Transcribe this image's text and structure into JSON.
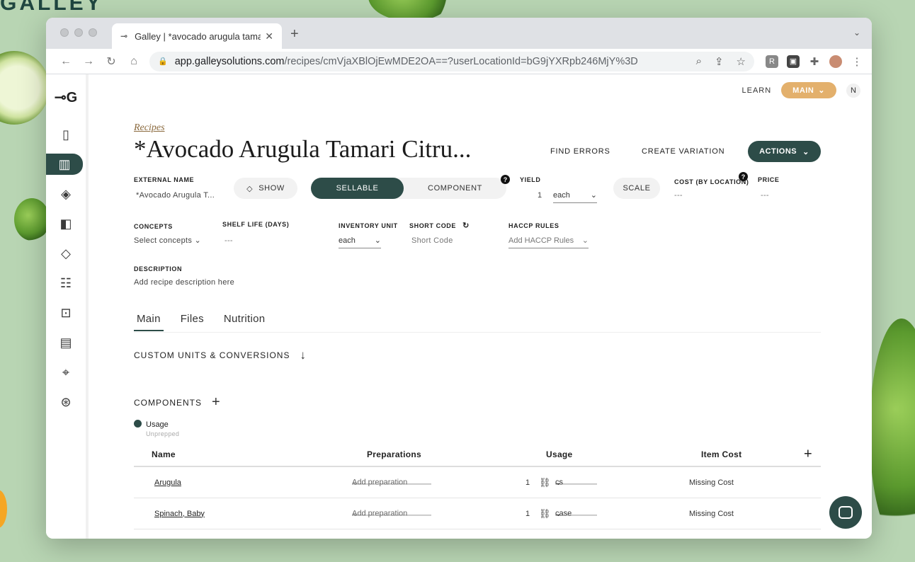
{
  "background": {
    "brand_text": "GALLEY"
  },
  "browser": {
    "tab_title": "Galley | *avocado arugula tama",
    "url_host": "app.galleysolutions.com",
    "url_path": "/recipes/cmVjaXBlOjEwMDE2OA==?userLocationId=bG9jYXRpb246MjY%3D"
  },
  "header": {
    "learn": "LEARN",
    "location": "MAIN",
    "user_initial": "N"
  },
  "recipe": {
    "breadcrumb": "Recipes",
    "title": "*Avocado Arugula Tamari Citru...",
    "find_errors": "FIND ERRORS",
    "create_variation": "CREATE VARIATION",
    "actions": "ACTIONS"
  },
  "fields": {
    "external_name_label": "EXTERNAL NAME",
    "external_name_value": "*Avocado Arugula T...",
    "show_label": "SHOW",
    "sellable_label": "SELLABLE",
    "component_label": "COMPONENT",
    "yield_label": "YIELD",
    "yield_qty": "1",
    "yield_unit": "each",
    "scale_label": "SCALE",
    "cost_label": "COST (BY LOCATION)",
    "cost_value": "---",
    "price_label": "PRICE",
    "price_value": "---",
    "concepts_label": "CONCEPTS",
    "concepts_value": "Select concepts",
    "shelf_life_label": "SHELF LIFE (DAYS)",
    "shelf_life_value": "---",
    "inventory_unit_label": "INVENTORY UNIT",
    "inventory_unit_value": "each",
    "short_code_label": "SHORT CODE",
    "short_code_placeholder": "Short Code",
    "haccp_label": "HACCP RULES",
    "haccp_placeholder": "Add HACCP Rules",
    "description_label": "DESCRIPTION",
    "description_placeholder": "Add recipe description here"
  },
  "tabs": [
    {
      "label": "Main"
    },
    {
      "label": "Files"
    },
    {
      "label": "Nutrition"
    }
  ],
  "sections": {
    "custom_units": "CUSTOM UNITS & CONVERSIONS",
    "components": "COMPONENTS"
  },
  "legend": {
    "usage": "Usage",
    "unprepped": "Unprepped"
  },
  "table": {
    "headers": {
      "name": "Name",
      "preparations": "Preparations",
      "usage": "Usage",
      "item_cost": "Item Cost"
    },
    "rows": [
      {
        "name": "Arugula",
        "preparation": "Add preparation",
        "qty": "1",
        "unit": "cs",
        "cost": "Missing Cost"
      },
      {
        "name": "Spinach, Baby",
        "preparation": "Add preparation",
        "qty": "1",
        "unit": "case",
        "cost": "Missing Cost"
      }
    ]
  }
}
